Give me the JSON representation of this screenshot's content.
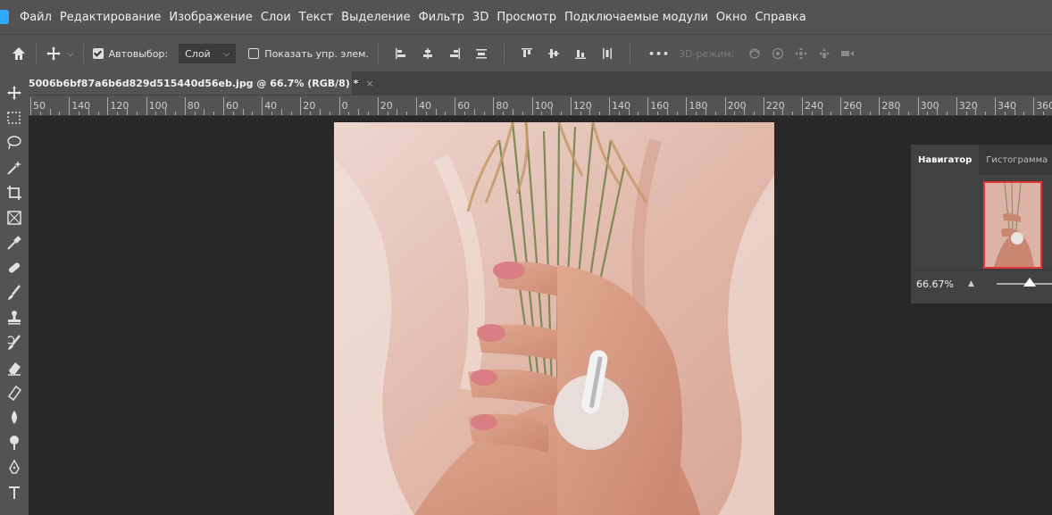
{
  "menubar": {
    "items": [
      "Файл",
      "Редактирование",
      "Изображение",
      "Слои",
      "Текст",
      "Выделение",
      "Фильтр",
      "3D",
      "Просмотр",
      "Подключаемые модули",
      "Окно",
      "Справка"
    ]
  },
  "options": {
    "autoselect_label": "Автовыбор:",
    "autoselect_checked": true,
    "layer_select_value": "Слой",
    "show_controls_label": "Показать упр. элем.",
    "show_controls_checked": false,
    "more_label": "•••",
    "mode3d_label": "3D-режим:"
  },
  "document_tab": {
    "title": "5006b6bf87a6b6d829d515440d56eb.jpg @ 66.7% (RGB/8) *",
    "close_glyph": "×"
  },
  "ruler": {
    "labels": [
      "50",
      "140",
      "120",
      "100",
      "80",
      "60",
      "40",
      "20",
      "0",
      "20",
      "40",
      "60",
      "80",
      "100",
      "120",
      "140",
      "160",
      "180",
      "200",
      "220",
      "240",
      "260",
      "280",
      "300",
      "320",
      "340",
      "360"
    ]
  },
  "navigator": {
    "tab_navigator": "Навигатор",
    "tab_histogram": "Гистограмма",
    "zoom_value": "66.67%",
    "zoom_level": 0.6667
  },
  "colors": {
    "accent": "#31a8ff",
    "thumb_border": "#e0333a",
    "panel_bg": "#424242",
    "chrome_bg": "#535353",
    "workspace_bg": "#282828"
  },
  "tools": [
    "move-tool-icon",
    "marquee-tool-icon",
    "lasso-tool-icon",
    "magic-wand-tool-icon",
    "crop-tool-icon",
    "frame-tool-icon",
    "eyedropper-tool-icon",
    "healing-brush-tool-icon",
    "brush-tool-icon",
    "stamp-tool-icon",
    "history-brush-tool-icon",
    "eraser-tool-icon",
    "gradient-tool-icon",
    "blur-tool-icon",
    "dodge-tool-icon",
    "pen-tool-icon",
    "type-tool-icon"
  ]
}
